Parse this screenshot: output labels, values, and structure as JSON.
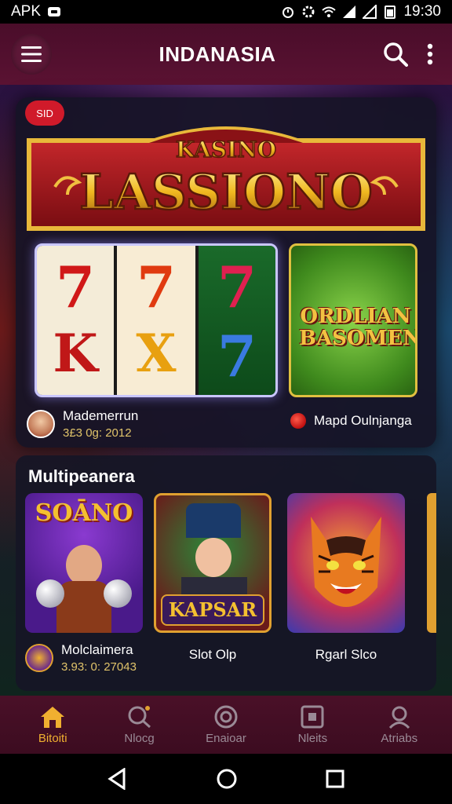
{
  "status_bar": {
    "left_text": "APK",
    "time": "19:30"
  },
  "app_bar": {
    "title": "INDANASIA"
  },
  "featured": {
    "badge": "SID",
    "banner_top": "KASINO",
    "banner_main": "LASSIONO",
    "slot_symbols": [
      "7",
      "7",
      "7",
      "K",
      "X",
      "7"
    ],
    "side_game_text": "ORDLIAN BASOMEN",
    "player1": {
      "name": "Mademerrun",
      "meta": "3£3 0ɡ: 2012"
    },
    "player2": {
      "name": "Mapd Oulnjanga"
    }
  },
  "multiplayer": {
    "title": "Multipeanera",
    "games": [
      {
        "art_text": "SOĀNO",
        "caption": "Molclaimera",
        "meta": "3.93: 0: 27043"
      },
      {
        "art_text": "KAPSAR",
        "caption": "Slot Olp"
      },
      {
        "art_text": "",
        "caption": "Rgarl Slco"
      }
    ]
  },
  "bottom_nav": [
    {
      "label": "Bitoiti",
      "icon": "home-icon",
      "active": true
    },
    {
      "label": "Nlocg",
      "icon": "search-icon",
      "active": false
    },
    {
      "label": "Enaioar",
      "icon": "chip-icon",
      "active": false
    },
    {
      "label": "Nleits",
      "icon": "grid-icon",
      "active": false
    },
    {
      "label": "Atriabs",
      "icon": "profile-icon",
      "active": false
    }
  ],
  "colors": {
    "accent": "#f0b030",
    "app_bar": "#4a0d2a",
    "badge": "#d01a2a"
  }
}
